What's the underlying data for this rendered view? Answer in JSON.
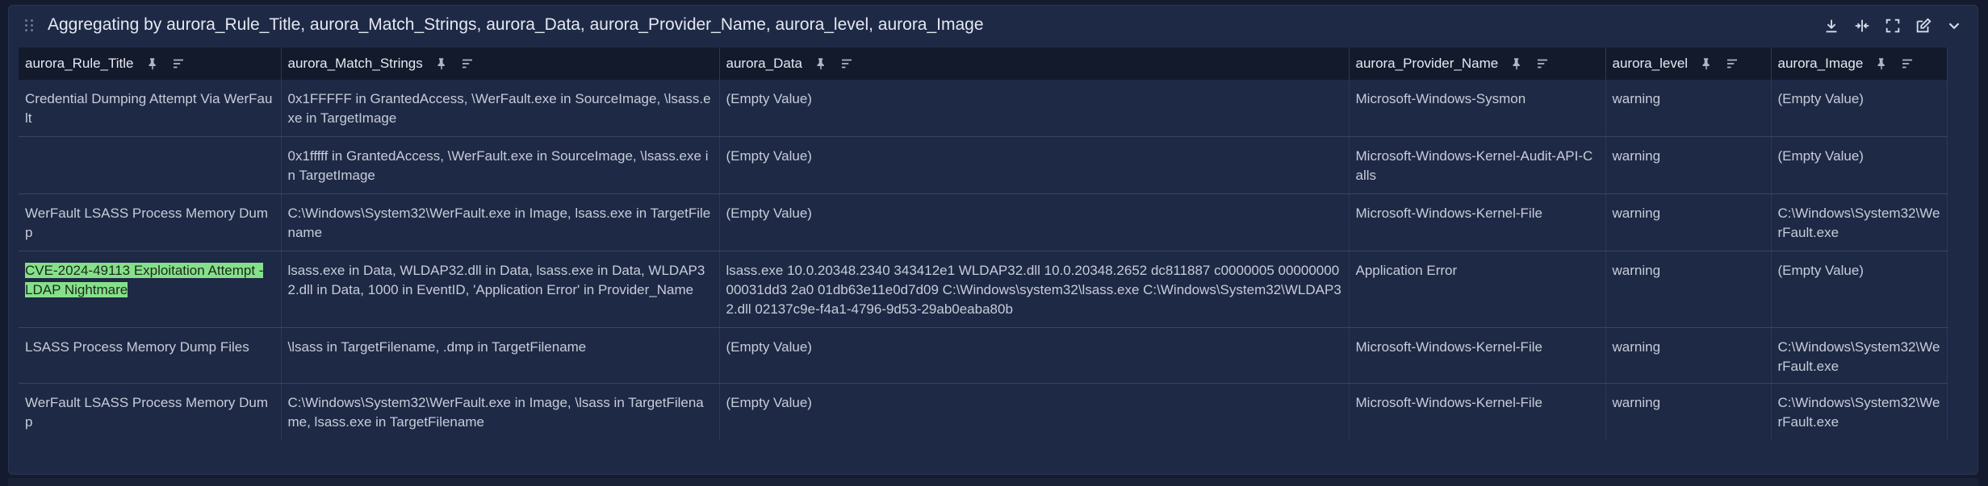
{
  "panel": {
    "title": "Aggregating by aurora_Rule_Title, aurora_Match_Strings, aurora_Data, aurora_Provider_Name, aurora_level, aurora_Image",
    "tools": [
      "download-icon",
      "split-columns-icon",
      "fullscreen-icon",
      "edit-icon",
      "chevron-down-icon"
    ]
  },
  "table": {
    "columns": [
      {
        "label": "aurora_Rule_Title"
      },
      {
        "label": "aurora_Match_Strings"
      },
      {
        "label": "aurora_Data"
      },
      {
        "label": "aurora_Provider_Name"
      },
      {
        "label": "aurora_level"
      },
      {
        "label": "aurora_Image"
      }
    ],
    "rows": [
      {
        "rule_title": "Credential Dumping Attempt Via WerFault",
        "match_strings": "0x1FFFFF in GrantedAccess, \\WerFault.exe in SourceImage, \\lsass.exe in TargetImage",
        "data": "(Empty Value)",
        "provider": "Microsoft-Windows-Sysmon",
        "level": "warning",
        "image": "(Empty Value)"
      },
      {
        "rule_title": "",
        "match_strings": "0x1fffff in GrantedAccess, \\WerFault.exe in SourceImage, \\lsass.exe in TargetImage",
        "data": "(Empty Value)",
        "provider": "Microsoft-Windows-Kernel-Audit-API-Calls",
        "level": "warning",
        "image": "(Empty Value)"
      },
      {
        "rule_title": "WerFault LSASS Process Memory Dump",
        "match_strings": "C:\\Windows\\System32\\WerFault.exe in Image, lsass.exe in TargetFilename",
        "data": "(Empty Value)",
        "provider": "Microsoft-Windows-Kernel-File",
        "level": "warning",
        "image": "C:\\Windows\\System32\\WerFault.exe"
      },
      {
        "rule_title": "CVE-2024-49113 Exploitation Attempt - LDAP Nightmare",
        "match_strings": "lsass.exe in Data, WLDAP32.dll in Data, lsass.exe in Data, WLDAP32.dll in Data, 1000 in EventID, 'Application Error' in Provider_Name",
        "data": "lsass.exe 10.0.20348.2340 343412e1 WLDAP32.dll 10.0.20348.2652 dc811887 c0000005 0000000000031dd3 2a0 01db63e11e0d7d09 C:\\Windows\\system32\\lsass.exe C:\\Windows\\System32\\WLDAP32.dll 02137c9e-f4a1-4796-9d53-29ab0eaba80b",
        "provider": "Application Error",
        "level": "warning",
        "image": "(Empty Value)",
        "highlighted": true
      },
      {
        "rule_title": "LSASS Process Memory Dump Files",
        "match_strings": "\\lsass in TargetFilename, .dmp in TargetFilename",
        "data": "(Empty Value)",
        "provider": "Microsoft-Windows-Kernel-File",
        "level": "warning",
        "image": "C:\\Windows\\System32\\WerFault.exe"
      },
      {
        "rule_title": "WerFault LSASS Process Memory Dump",
        "match_strings": "C:\\Windows\\System32\\WerFault.exe in Image, \\lsass in TargetFilename, lsass.exe in TargetFilename",
        "data": "(Empty Value)",
        "provider": "Microsoft-Windows-Kernel-File",
        "level": "warning",
        "image": "C:\\Windows\\System32\\WerFault.exe"
      }
    ]
  },
  "colors": {
    "background": "#141b2e",
    "panel": "#1e2945",
    "header_row": "#131a2c",
    "highlight": "#86e08a"
  }
}
